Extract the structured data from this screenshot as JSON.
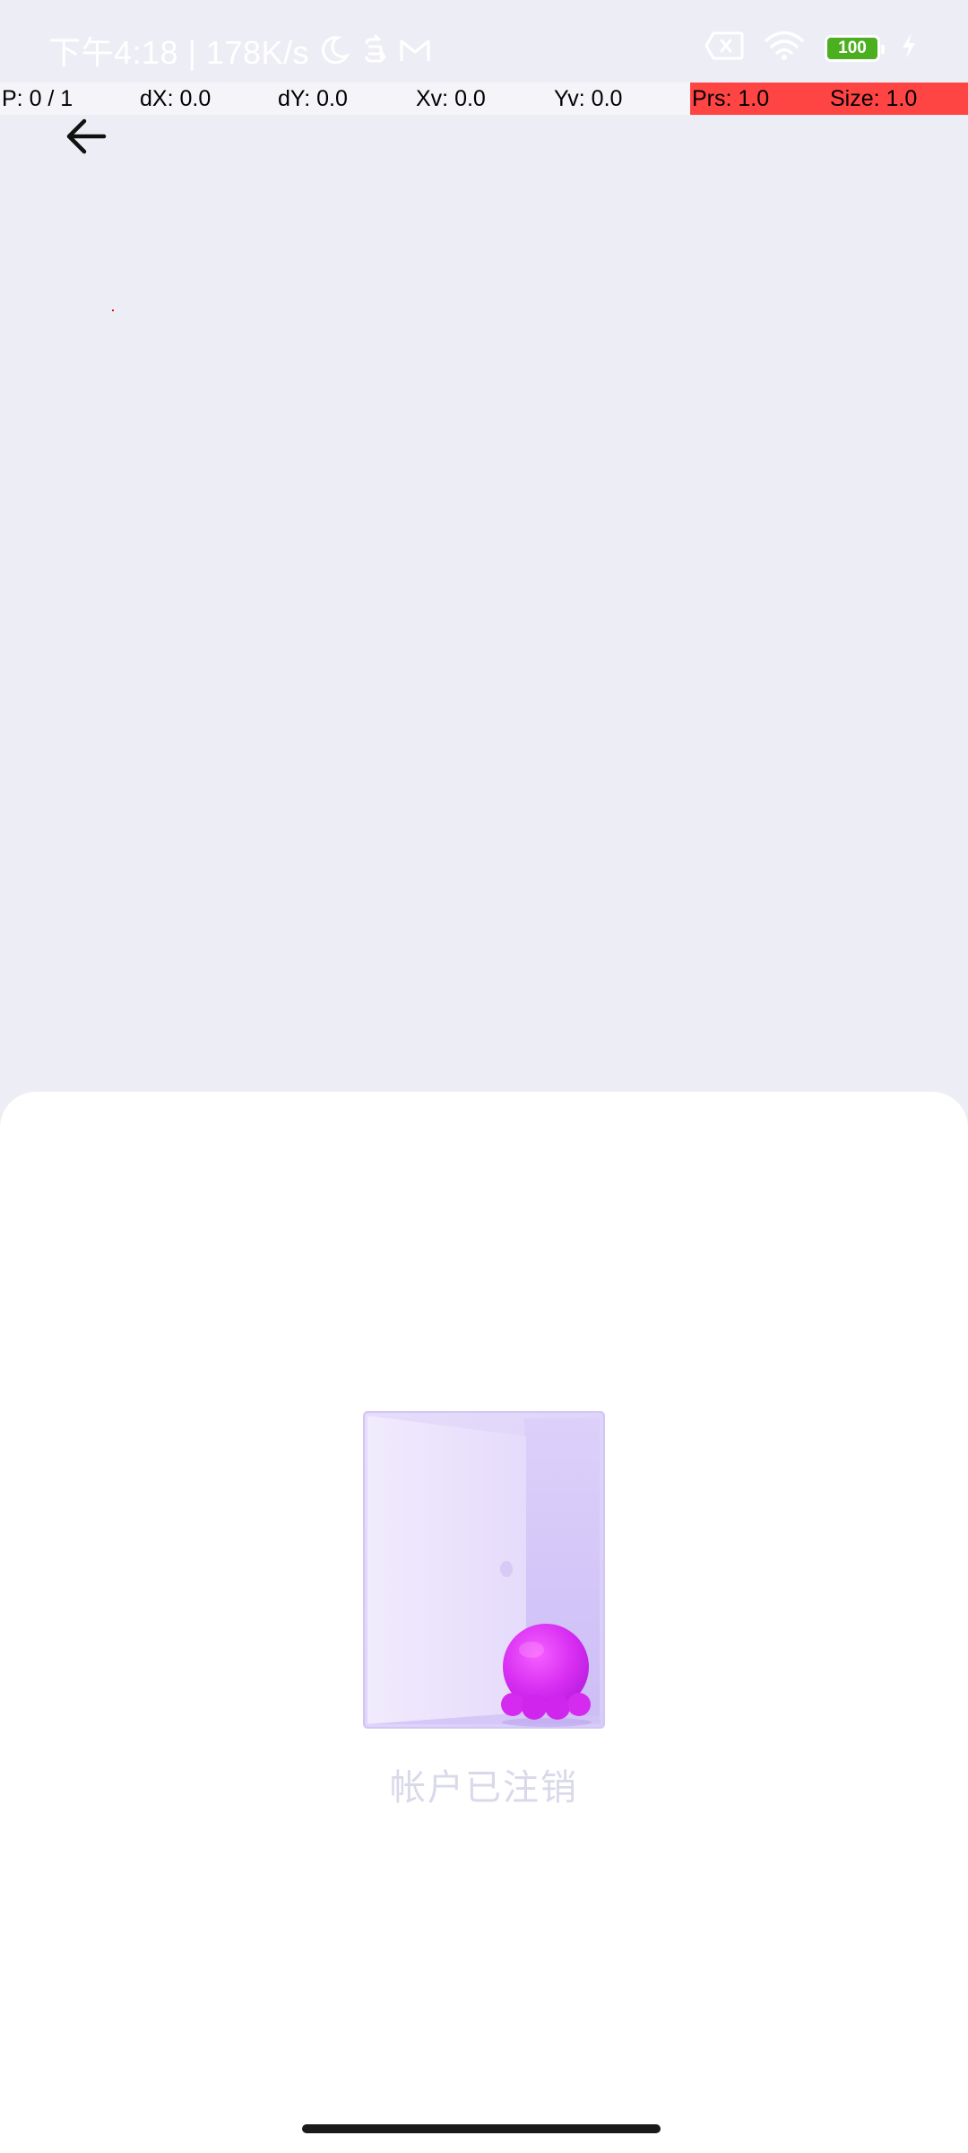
{
  "status_bar": {
    "time_speed": "下午4:18 | 178K/s",
    "battery_level": "100",
    "battery_color": "#4CAF1F",
    "icons": [
      "moon-icon",
      "sync-icon",
      "gmail-icon",
      "sim-card-off-icon",
      "wifi-icon",
      "battery-icon",
      "charging-bolt-icon"
    ]
  },
  "pointer_bar": {
    "p": "P: 0 / 1",
    "dx": "dX: 0.0",
    "dy": "dY: 0.0",
    "xv": "Xv: 0.0",
    "yv": "Yv: 0.0",
    "prs": "Prs: 1.0",
    "size": "Size: 1.0",
    "highlight_color": "#FF4444"
  },
  "nav": {
    "back_icon": "arrow-left-icon"
  },
  "content": {
    "empty_message": "帐户已注销",
    "illustration": "open-door-octopus-illustration"
  }
}
